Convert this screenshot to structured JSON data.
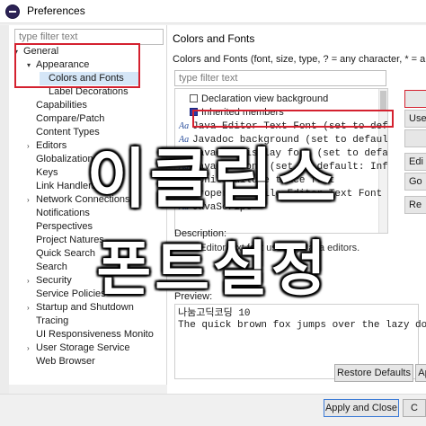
{
  "window": {
    "title": "Preferences"
  },
  "left": {
    "filter_placeholder": "type filter text",
    "tree": [
      {
        "label": "General",
        "caret": "▾",
        "level": 0
      },
      {
        "label": "Appearance",
        "caret": "▾",
        "level": 1
      },
      {
        "label": "Colors and Fonts",
        "caret": "",
        "level": 2,
        "selected": true
      },
      {
        "label": "Label Decorations",
        "caret": "",
        "level": 2
      },
      {
        "label": "Capabilities",
        "caret": "",
        "level": 1
      },
      {
        "label": "Compare/Patch",
        "caret": "",
        "level": 1
      },
      {
        "label": "Content Types",
        "caret": "",
        "level": 1
      },
      {
        "label": "Editors",
        "caret": "›",
        "level": 1
      },
      {
        "label": "Globalization",
        "caret": "",
        "level": 1
      },
      {
        "label": "Keys",
        "caret": "",
        "level": 1
      },
      {
        "label": "Link Handlers",
        "caret": "",
        "level": 1
      },
      {
        "label": "Network Connections",
        "caret": "›",
        "level": 1
      },
      {
        "label": "Notifications",
        "caret": "",
        "level": 1
      },
      {
        "label": "Perspectives",
        "caret": "",
        "level": 1
      },
      {
        "label": "Project Natures",
        "caret": "",
        "level": 1
      },
      {
        "label": "Quick Search",
        "caret": "",
        "level": 1
      },
      {
        "label": "Search",
        "caret": "",
        "level": 1
      },
      {
        "label": "Security",
        "caret": "›",
        "level": 1
      },
      {
        "label": "Service Policies",
        "caret": "",
        "level": 1
      },
      {
        "label": "Startup and Shutdown",
        "caret": "›",
        "level": 1
      },
      {
        "label": "Tracing",
        "caret": "",
        "level": 1
      },
      {
        "label": "UI Responsiveness Monito",
        "caret": "",
        "level": 1
      },
      {
        "label": "User Storage Service",
        "caret": "›",
        "level": 1
      },
      {
        "label": "Web Browser",
        "caret": "",
        "level": 1
      }
    ]
  },
  "right": {
    "header": "Colors and Fonts",
    "description": "Colors and Fonts (font, size, type, ? = any character, * = an",
    "filter_placeholder": "type filter text",
    "list": [
      {
        "kind": "color",
        "fill": false,
        "label": "Declaration view background"
      },
      {
        "kind": "color",
        "fill": true,
        "label": "Inherited members"
      },
      {
        "kind": "font",
        "label": "Java Editor Text Font (set to default: Conso"
      },
      {
        "kind": "font",
        "label": "Javadoc background (set to default: Inform"
      },
      {
        "kind": "font",
        "label": "Javadoc display font (set to default: Dialo"
      },
      {
        "kind": "font",
        "label": "Javadoc font (set to default: Informa"
      },
      {
        "kind": "font",
        "label": "JUnit failure trace font"
      },
      {
        "kind": "font",
        "label": "Properties File Editor Text Font (set"
      },
      {
        "kind": "font",
        "label": "JavaScript"
      }
    ],
    "buttons": {
      "use": "Use",
      "edit": "Edi",
      "goto": "Go",
      "reset": "Re"
    },
    "description_label": "Description:",
    "description_text": "Java Editor text font used by Java editors.",
    "preview_label": "Preview:",
    "preview_text": "나눔고딕코딩 10\nThe quick brown fox jumps over the lazy dog.",
    "restore_defaults": "Restore Defaults",
    "apply": "Ap",
    "apply_and_close": "Apply and Close",
    "cancel": "C"
  },
  "overlay": {
    "line1": "이클립스",
    "line2": "폰트설정"
  },
  "colors": {
    "highlight_red": "#d4212f",
    "selection": "#d5e6f7",
    "overlay_text": "#ffffff"
  }
}
